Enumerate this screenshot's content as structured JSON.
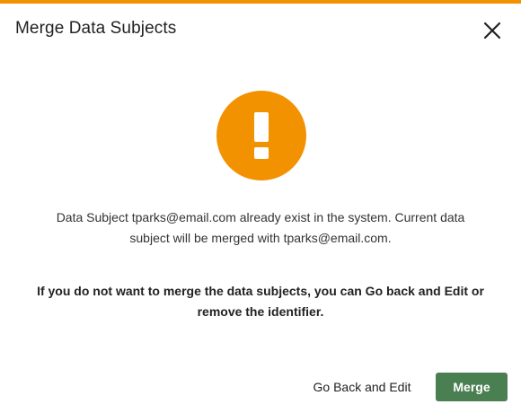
{
  "dialog": {
    "title": "Merge Data Subjects",
    "accent_color": "#f39200",
    "icons": {
      "close": "close-icon",
      "warning": "exclamation-icon"
    },
    "message_line1": "Data Subject tparks@email.com already exist in the system. Current data",
    "message_line2": "subject will be merged with tparks@email.com.",
    "warning_line1": "If you do not want to merge the data subjects, you can Go back and Edit or",
    "warning_line2": "remove the identifier.",
    "back_label": "Go Back and Edit",
    "merge_label": "Merge",
    "merge_color": "#4a7f52"
  }
}
